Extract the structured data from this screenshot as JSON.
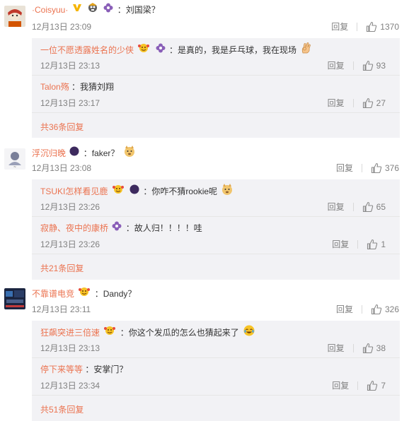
{
  "common": {
    "reply_label": "回复"
  },
  "comments": [
    {
      "username": "·Coisyuu·",
      "text": "：刘国梁？",
      "time": "12月13日 23:09",
      "likes": "1370",
      "replies": [
        {
          "username": "一位不愿透露姓名的少侠",
          "text": "：是真的，我是乒乓球，我在现场",
          "time": "12月13日 23:13",
          "likes": "93"
        },
        {
          "username": "Talon殇",
          "text": "：我猜刘翔",
          "time": "12月13日 23:17",
          "likes": "27"
        }
      ],
      "more": "共36条回复"
    },
    {
      "username": "浮沉归晚",
      "text": "：faker？",
      "time": "12月13日 23:08",
      "likes": "376",
      "replies": [
        {
          "username": "TSUKI怎样看见鹿",
          "text": "：你咋不猜rookie呢",
          "time": "12月13日 23:26",
          "likes": "65"
        },
        {
          "username": "寂静、夜中的康桥",
          "text": "：故人归！！！！哇",
          "time": "12月13日 23:26",
          "likes": "1"
        }
      ],
      "more": "共21条回复"
    },
    {
      "username": "不靠谱电竞",
      "text": "：Dandy？",
      "time": "12月13日 23:11",
      "likes": "326",
      "replies": [
        {
          "username": "狂飙突进三倍速",
          "text": "：你这个发瓜的怎么也猜起来了",
          "time": "12月13日 23:13",
          "likes": "38"
        },
        {
          "username": "停下来等等",
          "text": "：安掌门？",
          "time": "12月13日 23:34",
          "likes": "7"
        }
      ],
      "more": "共51条回复"
    }
  ],
  "colors": {
    "link": "#eb7350",
    "meta": "#808080",
    "reply_bg": "#f2f2f5",
    "vip_purple": "#8a5fb8",
    "verified_yellow": "#f5b400"
  }
}
